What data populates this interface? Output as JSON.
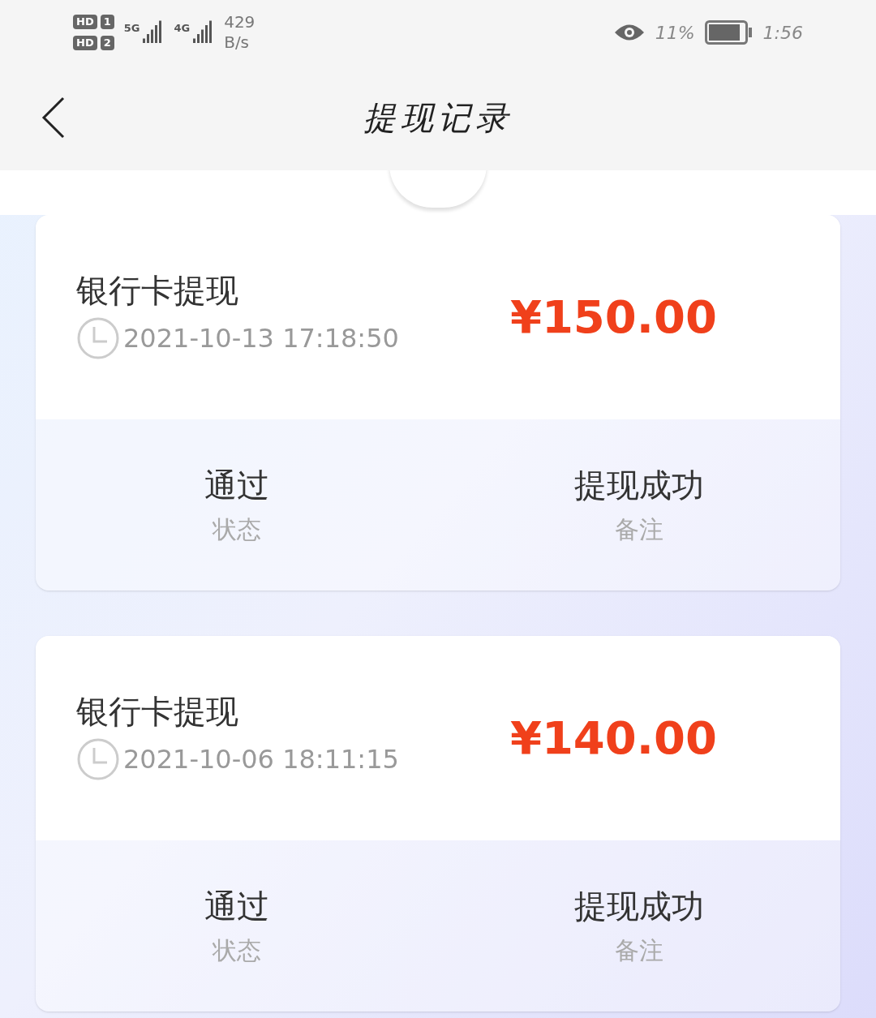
{
  "status_bar": {
    "sim_badges": [
      "HD",
      "1",
      "HD",
      "2"
    ],
    "networks": [
      "5G",
      "4G"
    ],
    "speed": [
      "429",
      "B/s"
    ],
    "battery": "11%",
    "time": "1:56"
  },
  "header": {
    "title": "提现记录"
  },
  "records": [
    {
      "title": "银行卡提现",
      "time": "2021-10-13 17:18:50",
      "amount": "¥150.00",
      "fields": [
        {
          "value": "通过",
          "label": "状态"
        },
        {
          "value": "提现成功",
          "label": "备注"
        }
      ]
    },
    {
      "title": "银行卡提现",
      "time": "2021-10-06 18:11:15",
      "amount": "¥140.00",
      "fields": [
        {
          "value": "通过",
          "label": "状态"
        },
        {
          "value": "提现成功",
          "label": "备注"
        }
      ]
    }
  ]
}
